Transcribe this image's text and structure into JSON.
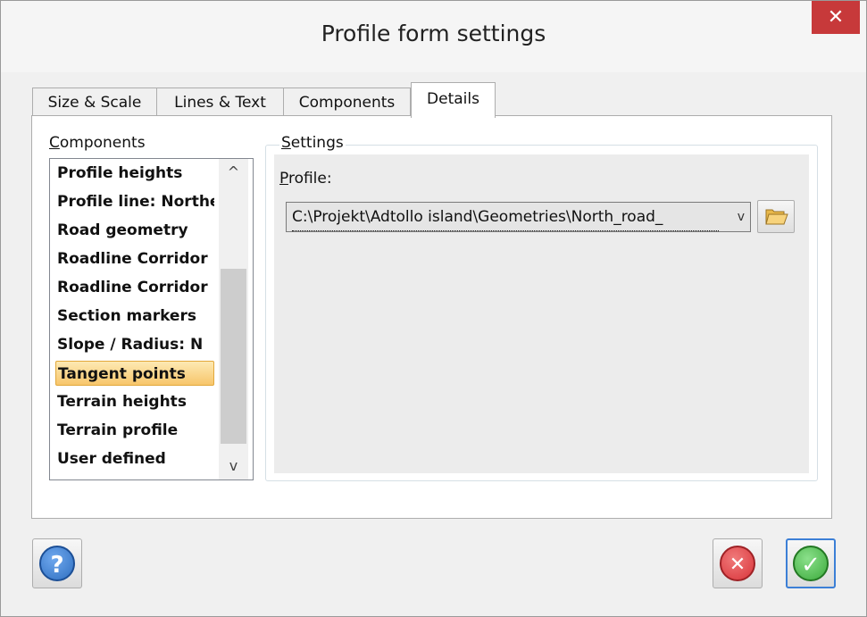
{
  "window": {
    "title": "Profile form settings",
    "close_glyph": "✕"
  },
  "tabs": [
    {
      "label": "Size & Scale"
    },
    {
      "label": "Lines & Text"
    },
    {
      "label": "Components"
    },
    {
      "label": "Details",
      "active": true
    }
  ],
  "components": {
    "label_underlined": "C",
    "label_rest": "omponents",
    "items": [
      "Profile heights",
      "Profile line: Northern",
      "Road geometry",
      "Roadline Corridor",
      "Roadline Corridor",
      "Section markers",
      "Slope / Radius: N",
      "Tangent points",
      "Terrain heights",
      "Terrain profile",
      "User defined"
    ],
    "selected_item": "Tangent points",
    "scroll_up_glyph": "^",
    "scroll_down_glyph": "v"
  },
  "settings": {
    "title_underlined": "S",
    "title_rest": "ettings",
    "profile_label_underlined": "P",
    "profile_label_rest": "rofile:",
    "profile_value": "C:\\Projekt\\Adtollo island\\Geometries\\North_road_",
    "dropdown_glyph": "v"
  },
  "buttons": {
    "help_glyph": "?",
    "cancel_glyph": "✕",
    "ok_glyph": "✓"
  },
  "colors": {
    "close_bg": "#c7393a",
    "selection": "#f7c66b",
    "help_circle": "#2f6fc0",
    "cancel_circle": "#d9343a",
    "ok_circle": "#3cab3c",
    "ok_border": "#3c7fd6"
  },
  "icons": {
    "browse": "folder-icon",
    "help": "help-icon",
    "cancel": "cancel-icon",
    "ok": "ok-icon",
    "close": "close-icon"
  }
}
